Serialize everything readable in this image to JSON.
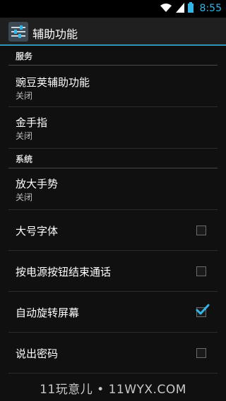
{
  "status_bar": {
    "time": "8:55",
    "icons": [
      "wifi-icon",
      "signal-icon",
      "battery-icon"
    ],
    "accent_color": "#33b5e5"
  },
  "action_bar": {
    "title": "辅助功能",
    "app_icon": "settings-sliders-icon",
    "underline_color": "#2f95b9"
  },
  "sections": [
    {
      "header": "服务",
      "items": [
        {
          "title": "豌豆荚辅助功能",
          "subtitle": "关闭"
        },
        {
          "title": "金手指",
          "subtitle": "关闭"
        }
      ]
    },
    {
      "header": "系统",
      "items": [
        {
          "title": "放大手势",
          "subtitle": "关闭"
        },
        {
          "title": "大号字体",
          "checked": false
        },
        {
          "title": "按电源按钮结束通话",
          "checked": false
        },
        {
          "title": "自动旋转屏幕",
          "checked": true
        },
        {
          "title": "说出密码",
          "checked": false
        }
      ]
    }
  ],
  "watermark": "11玩意儿 • 11WYX.COM"
}
